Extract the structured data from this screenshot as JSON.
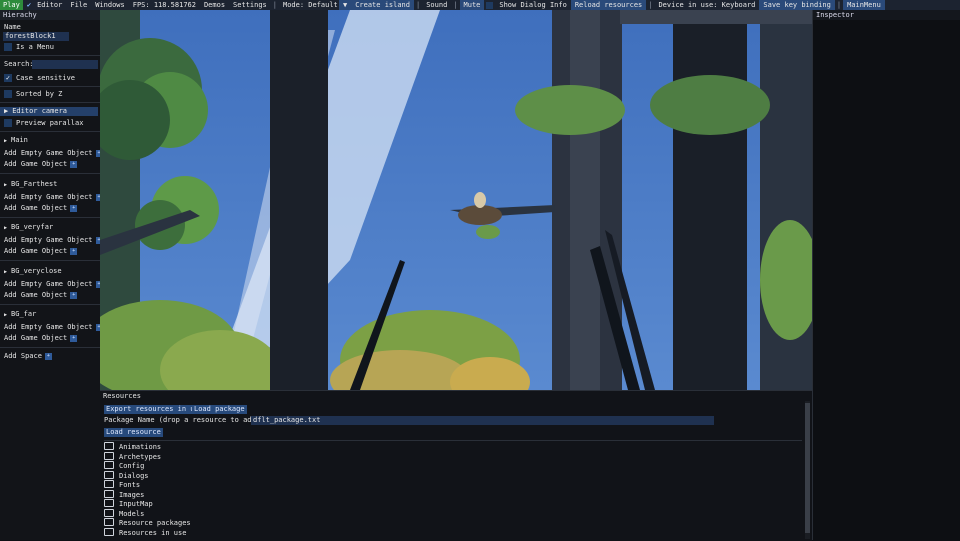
{
  "menubar": {
    "play": "Play",
    "editor": "Editor",
    "file": "File",
    "windows": "Windows",
    "fps": "FPS: 118.581762",
    "demos": "Demos",
    "settings": "Settings",
    "mode": "Mode: Default",
    "create_island": "Create island",
    "sound": "Sound",
    "mute": "Mute",
    "show_dialog_info": "Show Dialog Info",
    "reload_resources": "Reload resources",
    "device": "Device in use: Keyboard",
    "save_key_binding": "Save key binding",
    "main_menu": "MainMenu",
    "sep": "|"
  },
  "hierarchy": {
    "title": "Hierachy",
    "name_label": "Name",
    "name_value": "forestBlock1",
    "is_menu": "Is a Menu",
    "search_label": "Search:",
    "search_value": "",
    "case_sensitive": "Case sensitive",
    "sorted_by_z": "Sorted by Z",
    "editor_camera": "Editor camera",
    "preview_parallax": "Preview parallax",
    "layers": [
      {
        "name": "Main",
        "add_empty": "Add Empty Game Object",
        "add_game": "Add Game Object"
      },
      {
        "name": "BG_Farthest",
        "add_empty": "Add Empty Game Object",
        "add_game": "Add Game Object"
      },
      {
        "name": "BG_veryfar",
        "add_empty": "Add Empty Game Object",
        "add_game": "Add Game Object"
      },
      {
        "name": "BG_veryclose",
        "add_empty": "Add Empty Game Object",
        "add_game": "Add Game Object"
      },
      {
        "name": "BG_far",
        "add_empty": "Add Empty Game Object",
        "add_game": "Add Game Object"
      }
    ],
    "add_space": "Add Space",
    "plus": "+"
  },
  "inspector": {
    "title": "Inspector"
  },
  "resources": {
    "title": "Resources",
    "export_button": "Export resources in use",
    "load_package_button": "Load package",
    "package_label": "Package Name (drop a resource to add it):",
    "package_value": "dflt_package.txt",
    "load_resource_button": "Load resource",
    "folders": [
      "Animations",
      "Archetypes",
      "Config",
      "Dialogs",
      "Fonts",
      "Images",
      "InputMap",
      "Models",
      "Resource packages",
      "Resources in use"
    ]
  },
  "colors": {
    "menubar_bg": "#1c2330",
    "play_green": "#2e8b3c",
    "accent_blue": "#274a7c",
    "sky": "#4a7ac4"
  }
}
